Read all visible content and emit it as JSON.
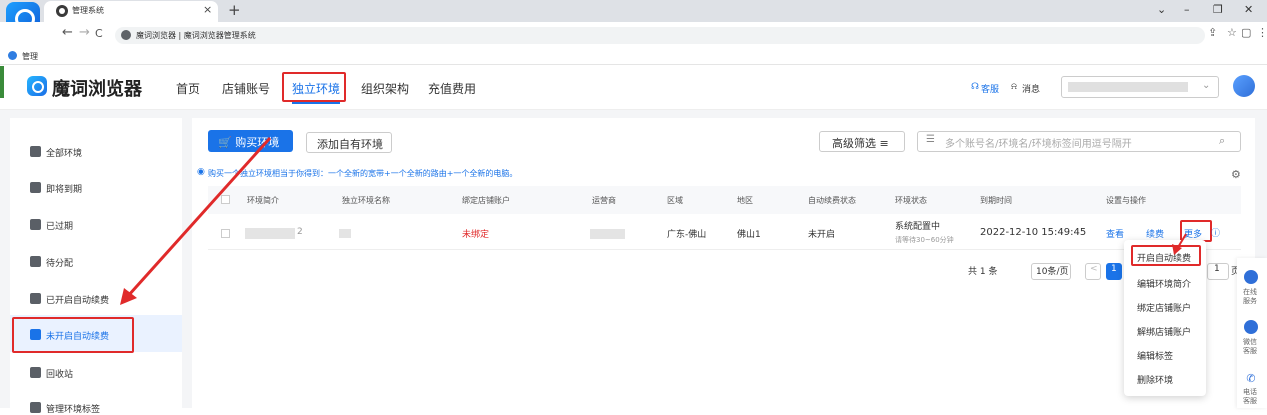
{
  "browser": {
    "tab_title": "管理系统",
    "tab_close": "×",
    "new_tab": "+",
    "window_controls": [
      "⌄",
      "–",
      "❐",
      "✕"
    ],
    "nav_buttons": [
      "←",
      "→",
      "C"
    ],
    "address": "魔词浏览器 | 魔词浏览器管理系统",
    "toolbar_icons": [
      "⇪",
      "☆",
      "▢",
      "⋮"
    ],
    "bookmark": "管理"
  },
  "header": {
    "logo_text": "魔词浏览器",
    "nav": [
      "首页",
      "店铺账号",
      "独立环境",
      "组织架构",
      "充值费用"
    ],
    "active_nav": "独立环境",
    "service": "客服",
    "messages": "消息",
    "user_chevron": "⌄"
  },
  "sidebar": {
    "items": [
      "全部环境",
      "即将到期",
      "已过期",
      "待分配",
      "已开启自动续费",
      "未开启自动续费",
      "回收站",
      "管理环境标签"
    ],
    "active": "未开启自动续费"
  },
  "toolbar": {
    "buy_label": "购买环境",
    "add_own_label": "添加自有环境",
    "filter_label": "高级筛选 ≡",
    "search_placeholder": "多个账号名/环境名/环境标签间用逗号隔开"
  },
  "notice": "购买一个独立环境相当于你得到：一个全新的宽带+一个全新的路由+一个全新的电脑。",
  "table": {
    "headers": [
      "环境简介",
      "独立环境名称",
      "绑定店铺账户",
      "运营商",
      "区域",
      "地区",
      "自动续费状态",
      "环境状态",
      "到期时间",
      "设置与操作"
    ],
    "row": {
      "intro": "2",
      "shop_account": "未绑定",
      "region": "广东-佛山",
      "area": "佛山1",
      "auto_renew": "未开启",
      "status": "系统配置中",
      "status_note": "请等待30~60分钟",
      "expire": "2022-12-10 15:49:45",
      "action_view": "查看",
      "action_renew": "续费",
      "action_more": "更多"
    }
  },
  "pagination": {
    "total": "共 1 条",
    "page_size": "10条/页",
    "prev": "<",
    "current": "1",
    "goto_value": "1",
    "goto_suffix": "页"
  },
  "dropdown": [
    "开启自动续费",
    "编辑环境简介",
    "绑定店铺账户",
    "解绑店铺账户",
    "编辑标签",
    "删除环境"
  ],
  "float_bar": [
    "在线服务",
    "微信客服",
    "电话客服"
  ],
  "colors": {
    "primary": "#1a73e8",
    "annotation_red": "#e02a2a"
  }
}
